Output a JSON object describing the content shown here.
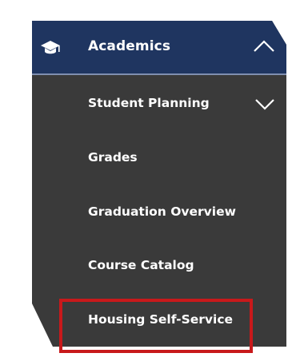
{
  "menu": {
    "header": {
      "label": "Academics",
      "icon": "graduation-cap-icon",
      "expand_icon": "chevron-up-icon",
      "background_color": "#1f3560"
    },
    "items": [
      {
        "label": "Student Planning",
        "has_submenu": true,
        "expand_icon": "chevron-down-icon"
      },
      {
        "label": "Grades",
        "has_submenu": false
      },
      {
        "label": "Graduation Overview",
        "has_submenu": false
      },
      {
        "label": "Course Catalog",
        "has_submenu": false
      },
      {
        "label": "Housing Self-Service",
        "has_submenu": false,
        "highlighted": true
      }
    ],
    "item_background_color": "#3a3a3a",
    "highlight_color": "#c8191b"
  }
}
